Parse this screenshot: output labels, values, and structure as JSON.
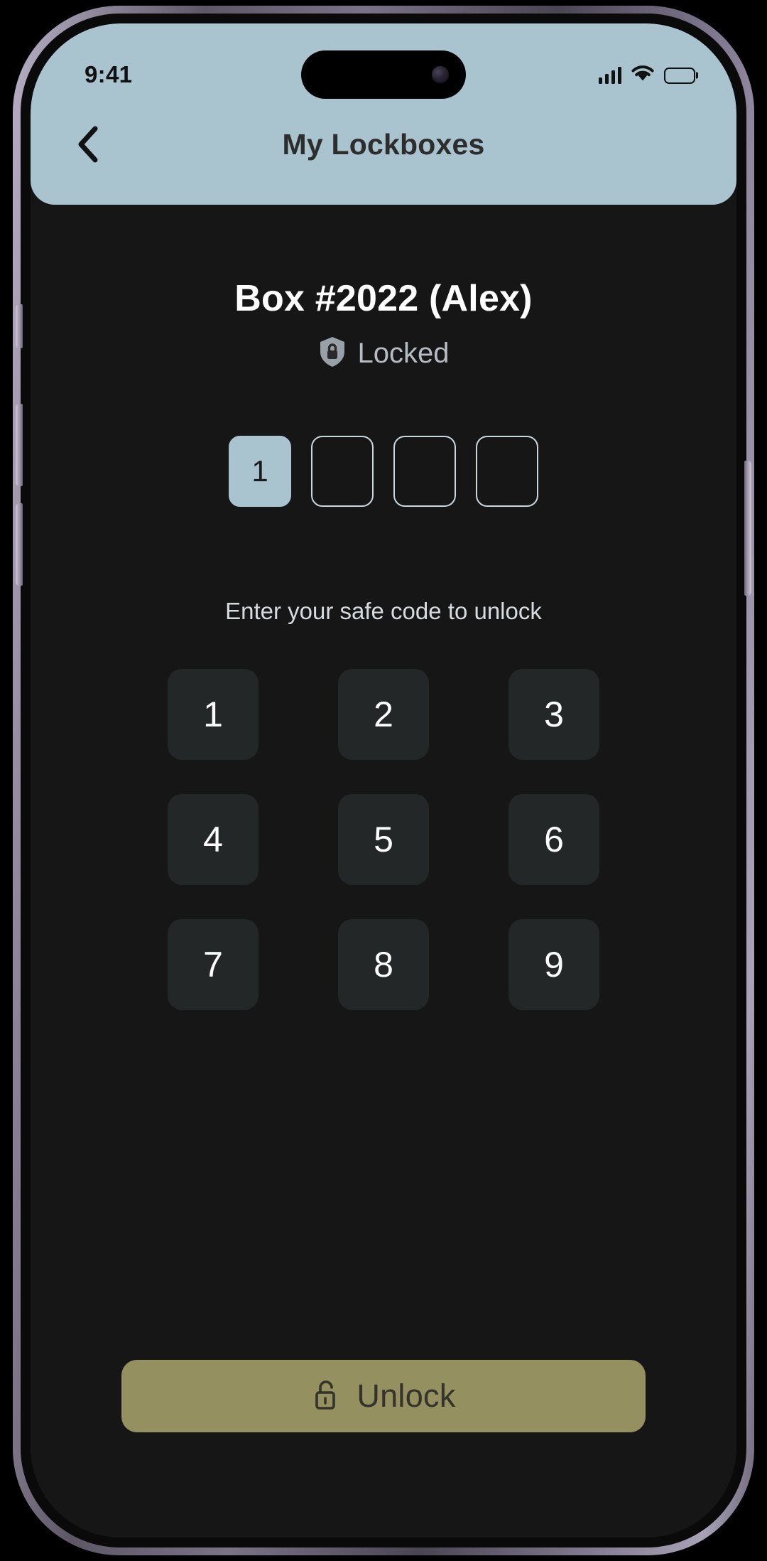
{
  "status_bar": {
    "time": "9:41",
    "icons": [
      "signal-bars-icon",
      "wifi-icon",
      "battery-icon"
    ]
  },
  "nav": {
    "back_icon": "chevron-left-icon",
    "title": "My Lockboxes"
  },
  "lockbox": {
    "title": "Box #2022 (Alex)",
    "status_icon": "shield-lock-icon",
    "status_label": "Locked"
  },
  "code_entry": {
    "length": 4,
    "cells": [
      {
        "value": "1",
        "filled": true
      },
      {
        "value": "",
        "filled": false
      },
      {
        "value": "",
        "filled": false
      },
      {
        "value": "",
        "filled": false
      }
    ],
    "hint": "Enter your safe code to unlock"
  },
  "keypad": {
    "keys": [
      "1",
      "2",
      "3",
      "4",
      "5",
      "6",
      "7",
      "8",
      "9"
    ]
  },
  "unlock": {
    "icon": "unlock-padlock-icon",
    "label": "Unlock"
  },
  "colors": {
    "header_bg": "#a9c4cf",
    "screen_bg": "#161616",
    "key_bg": "#242727",
    "accent_button": "#94905f",
    "accent_button_text": "#33332c",
    "code_cell_border": "#c9d6de",
    "status_text": "#b6bcc4"
  }
}
